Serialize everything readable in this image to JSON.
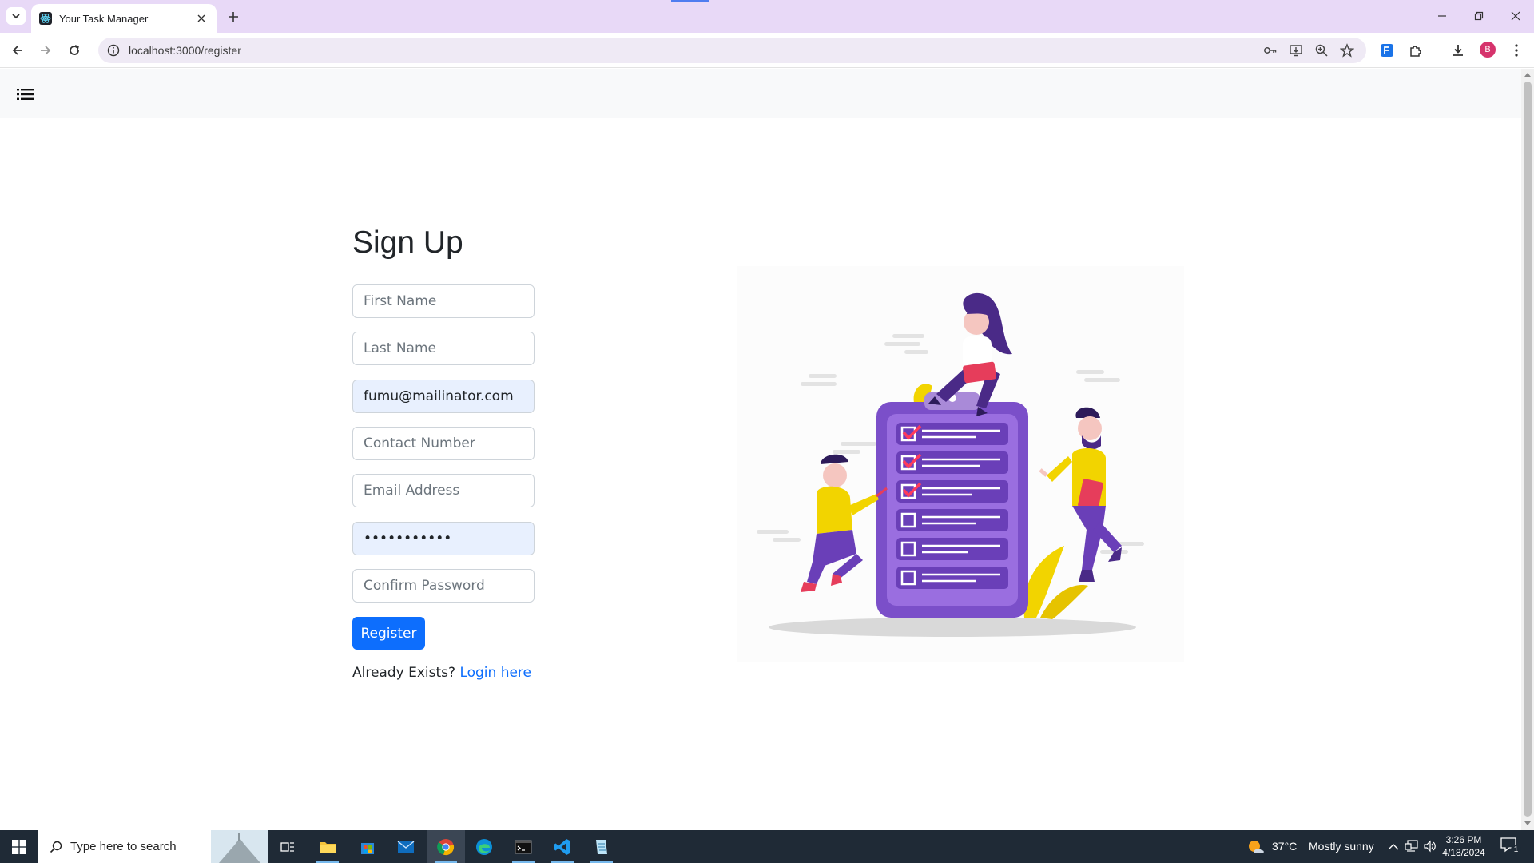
{
  "browser": {
    "tab_title": "Your Task Manager",
    "url": "localhost:3000/register",
    "profile_initial": "B"
  },
  "form": {
    "heading": "Sign Up",
    "first_name_placeholder": "First Name",
    "last_name_placeholder": "Last Name",
    "username_value": "fumu@mailinator.com",
    "contact_placeholder": "Contact Number",
    "email_placeholder": "Email Address",
    "password_value": "•••••••••••",
    "confirm_placeholder": "Confirm Password",
    "register_label": "Register",
    "login_prompt": "Already Exists?",
    "login_link": "Login here"
  },
  "taskbar": {
    "search_placeholder": "Type here to search",
    "weather_temp": "37°C",
    "weather_text": "Mostly sunny",
    "time": "3:26 PM",
    "date": "4/18/2024",
    "notification_count": "1"
  },
  "colors": {
    "primary": "#0d6efd",
    "tabstrip": "#e8d9f7",
    "autofill": "#e8f0fe",
    "illustration_purple": "#7b4fc9",
    "illustration_yellow": "#f2d400"
  }
}
